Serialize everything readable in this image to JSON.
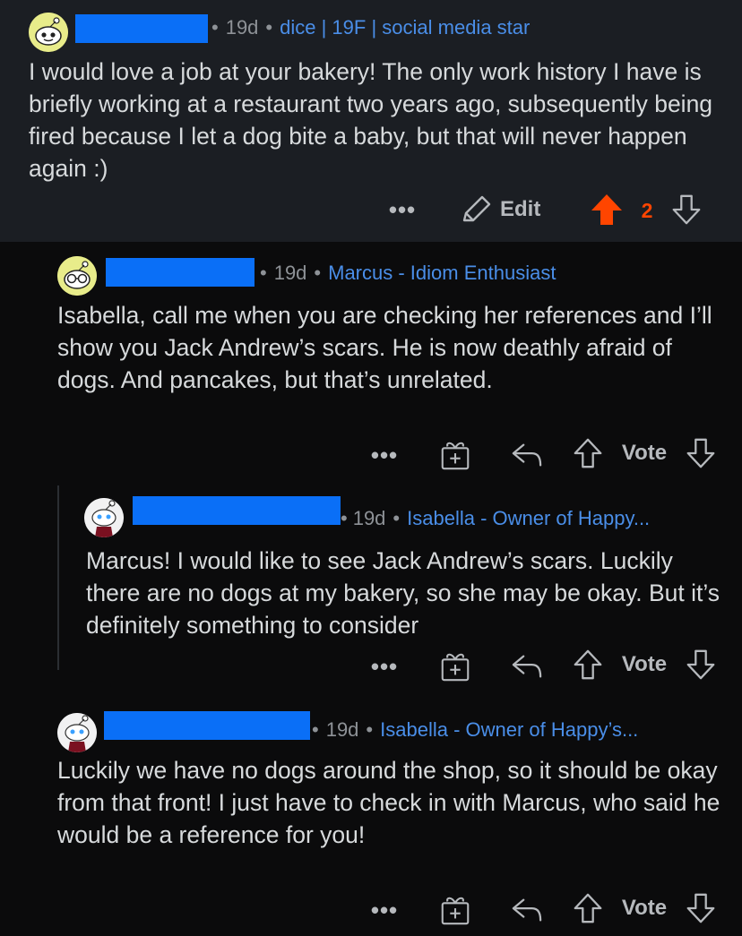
{
  "comments": [
    {
      "age": "19d",
      "flair": "dice | 19F | social media star",
      "body": "I would love a job at your bakery! The only work history I have is briefly working at a restaurant two years ago, subsequently being fired because I let a dog bite a baby, but that will never happen again :)",
      "actions": {
        "more": "•••",
        "edit": "Edit",
        "score": "2"
      },
      "colors": {
        "upvote": "#ff4500",
        "score": "#ff4500"
      }
    },
    {
      "age": "19d",
      "flair": "Marcus - Idiom Enthusiast",
      "body": "Isabella, call me when you are checking her references and I’ll show you Jack Andrew’s scars. He is now deathly afraid of dogs. And pancakes, but that’s unrelated.",
      "actions": {
        "more": "•••",
        "vote": "Vote"
      }
    },
    {
      "age": "19d",
      "flair": "Isabella - Owner of Happy...",
      "body": "Marcus! I would like to see Jack Andrew’s scars. Luckily there are no dogs at my bakery, so she may be okay. But it’s definitely something to consider",
      "actions": {
        "more": "•••",
        "vote": "Vote"
      }
    },
    {
      "age": "19d",
      "flair": "Isabella - Owner of Happy’s...",
      "body": "Luckily we have no dogs around the shop, so it should be okay from that front! I just have to check in with Marcus, who said he would be a reference for you!",
      "actions": {
        "more": "•••",
        "vote": "Vote"
      }
    }
  ],
  "colors": {
    "redaction": "#0a6ff7",
    "flair": "#4a8ee8",
    "background": "#0b0b0c",
    "top_comment_bg": "#1b1e23"
  }
}
